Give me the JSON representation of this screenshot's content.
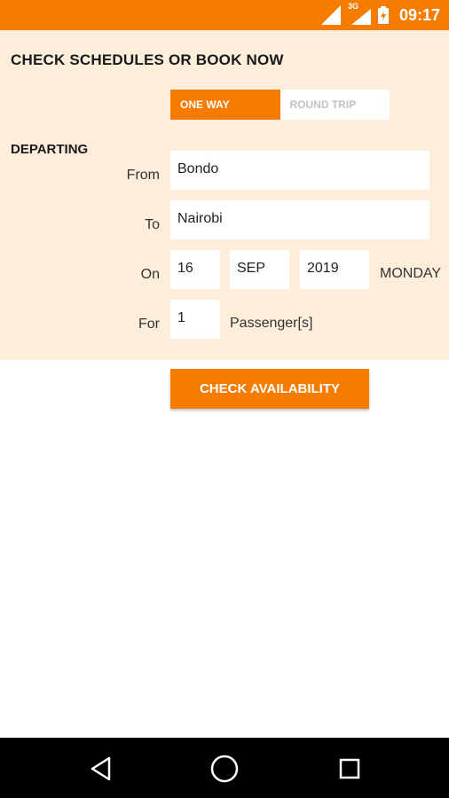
{
  "status_bar": {
    "time": "09:17",
    "network": "3G",
    "accent": "#f57c00"
  },
  "form": {
    "heading": "CHECK SCHEDULES OR BOOK NOW",
    "trip_type": {
      "one_way": "ONE WAY",
      "round_trip": "ROUND TRIP",
      "selected": "ONE WAY"
    },
    "section": "DEPARTING",
    "from_label": "From",
    "from_value": "Bondo",
    "to_label": "To",
    "to_value": "Nairobi",
    "on_label": "On",
    "date_day": "16",
    "date_month": "SEP",
    "date_year": "2019",
    "weekday": "MONDAY",
    "for_label": "For",
    "passengers": "1",
    "passengers_label": "Passenger[s]",
    "submit": "CHECK AVAILABILITY"
  },
  "nav": {
    "back": "back-icon",
    "home": "home-icon",
    "recents": "recents-icon"
  }
}
